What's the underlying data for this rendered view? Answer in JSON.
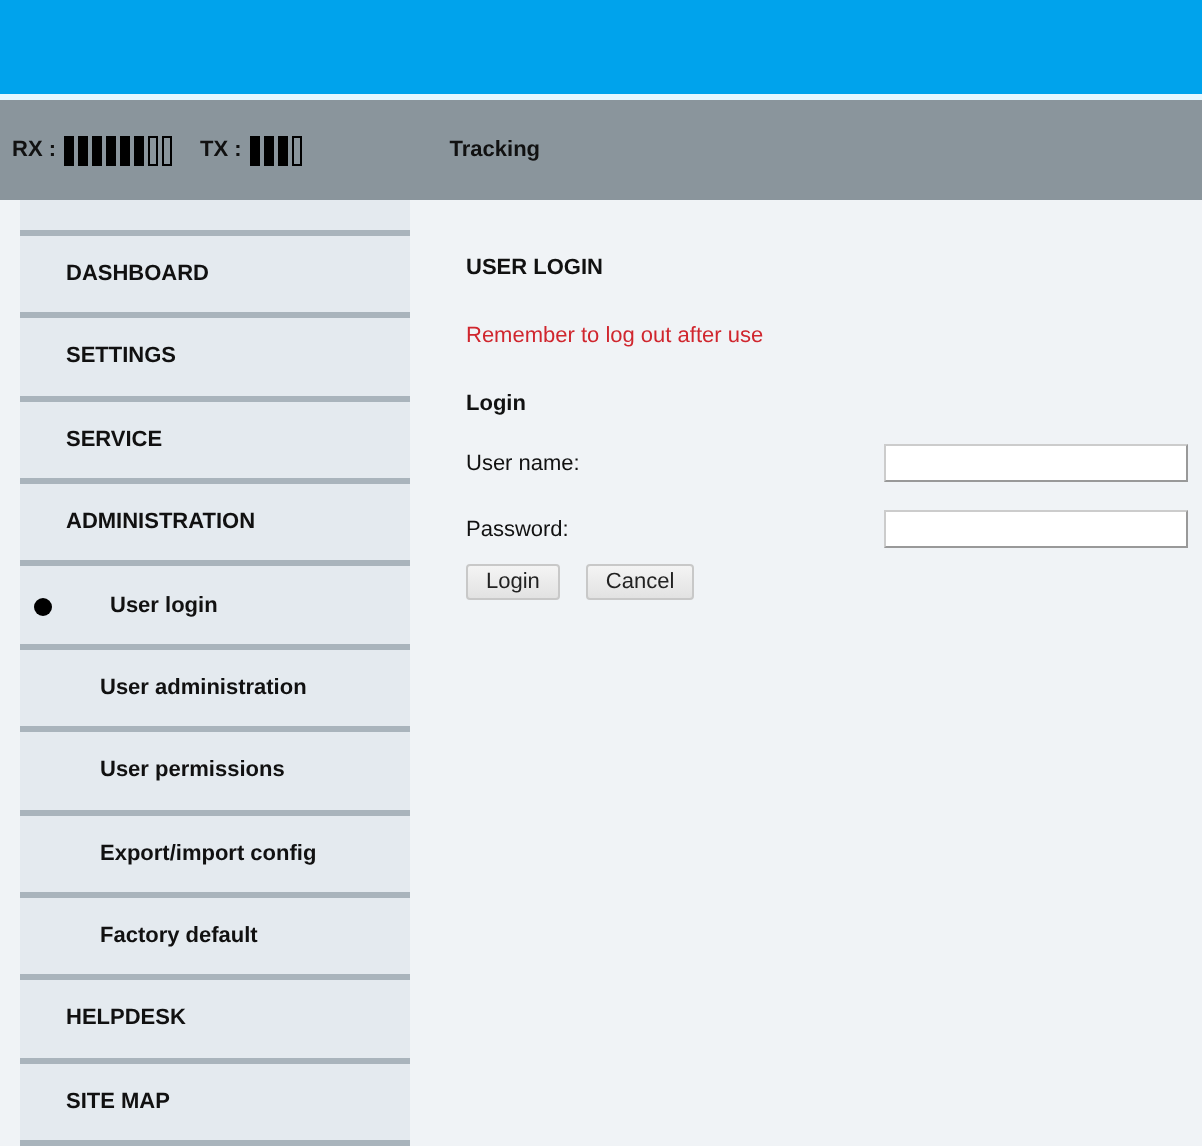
{
  "status_bar": {
    "rx": {
      "label": "RX :",
      "bars": [
        true,
        true,
        true,
        true,
        true,
        true,
        false,
        false
      ]
    },
    "tx": {
      "label": "TX :",
      "bars": [
        true,
        true,
        true,
        false
      ]
    },
    "mode": "Tracking"
  },
  "menu": [
    {
      "label": "DASHBOARD",
      "kind": "top",
      "selected": false
    },
    {
      "label": "SETTINGS",
      "kind": "top",
      "selected": false
    },
    {
      "label": "SERVICE",
      "kind": "top",
      "selected": false
    },
    {
      "label": "ADMINISTRATION",
      "kind": "top",
      "selected": false
    },
    {
      "label": "User login",
      "kind": "sub",
      "selected": true
    },
    {
      "label": "User administration",
      "kind": "sub",
      "selected": false
    },
    {
      "label": "User permissions",
      "kind": "sub",
      "selected": false
    },
    {
      "label": "Export/import config",
      "kind": "sub",
      "selected": false
    },
    {
      "label": "Factory default",
      "kind": "sub",
      "selected": false
    },
    {
      "label": "HELPDESK",
      "kind": "top",
      "selected": false
    },
    {
      "label": "SITE MAP",
      "kind": "top",
      "selected": false
    }
  ],
  "content": {
    "title": "USER LOGIN",
    "warning": "Remember to log out after use",
    "section": "Login",
    "fields": [
      {
        "label": "User name:"
      },
      {
        "label": "Password:"
      }
    ],
    "buttons": [
      "Login",
      "Cancel"
    ]
  }
}
